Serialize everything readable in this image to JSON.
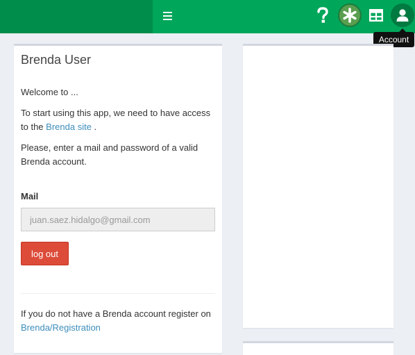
{
  "topbar": {
    "brand_color": "#008d4c",
    "bar_color": "#00a65a",
    "icons": [
      "hamburger-icon",
      "question-icon",
      "asterisk-icon",
      "table-icon",
      "user-icon"
    ]
  },
  "tooltip": {
    "text": "Account"
  },
  "panel": {
    "title": "Brenda User",
    "welcome": "Welcome to ...",
    "intro_prefix": "To start using this app, we need to have access to the",
    "intro_link": "Brenda site",
    "intro_suffix": ".",
    "instruction": "Please, enter a mail and password of a valid Brenda account.",
    "mail_label": "Mail",
    "mail_value": "juan.saez.hidalgo@gmail.com",
    "logout_label": "log out",
    "register_prefix": "If you do not have a Brenda account register on",
    "register_link": "Brenda/Registration",
    "button_color": "#dd4b39",
    "link_color": "#3c8dbc"
  }
}
